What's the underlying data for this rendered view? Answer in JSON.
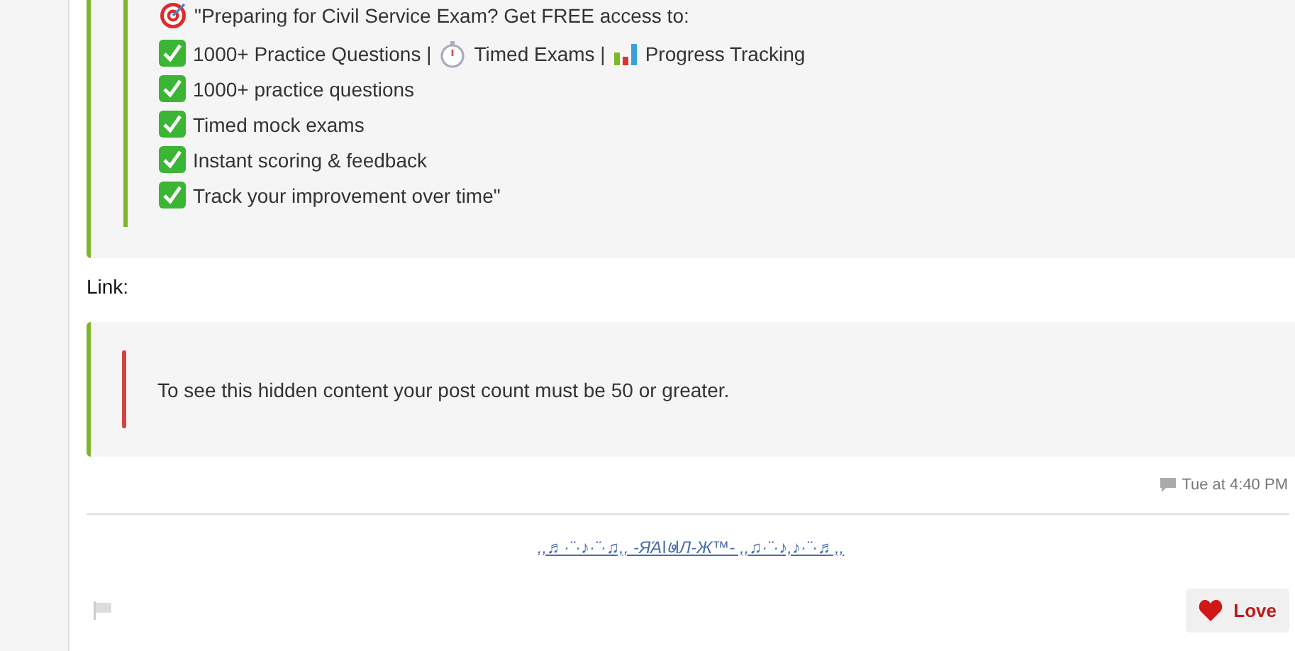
{
  "quote": {
    "lines": [
      {
        "parts": [
          {
            "kind": "target"
          },
          {
            "kind": "text",
            "text": "\"Preparing for Civil Service Exam? Get FREE access to:"
          }
        ]
      },
      {
        "parts": [
          {
            "kind": "check"
          },
          {
            "kind": "text",
            "text": "1000+ Practice Questions |"
          },
          {
            "kind": "stopwatch"
          },
          {
            "kind": "text",
            "text": "Timed Exams |"
          },
          {
            "kind": "chart"
          },
          {
            "kind": "text",
            "text": "Progress Tracking"
          }
        ]
      },
      {
        "parts": [
          {
            "kind": "check"
          },
          {
            "kind": "text",
            "text": "1000+ practice questions"
          }
        ]
      },
      {
        "parts": [
          {
            "kind": "check"
          },
          {
            "kind": "text",
            "text": "Timed mock exams"
          }
        ]
      },
      {
        "parts": [
          {
            "kind": "check"
          },
          {
            "kind": "text",
            "text": "Instant scoring & feedback"
          }
        ]
      },
      {
        "parts": [
          {
            "kind": "check"
          },
          {
            "kind": "text",
            "text": "Track your improvement over time\""
          }
        ]
      }
    ]
  },
  "link_label": "Link:",
  "hidden_notice": "To see this hidden content your post count must be 50 or greater.",
  "timestamp": "Tue at 4:40 PM",
  "signature": ",,♬·¨·♪·¨·♫,, -ЯΆǀ७ǀЛ-Ж™- ,,♫·¨·♪,♪·¨·♬,,",
  "love_button": {
    "label": "Love"
  }
}
